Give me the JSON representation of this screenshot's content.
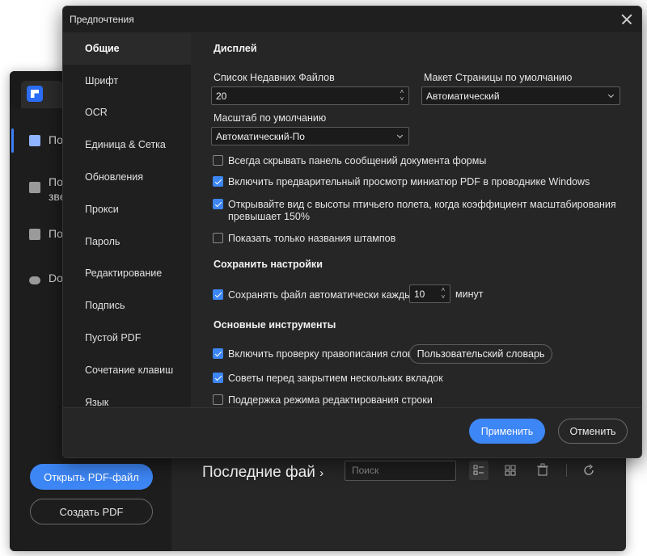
{
  "background_app": {
    "nav": [
      {
        "label": "По",
        "icon": "document-icon",
        "active": true
      },
      {
        "label": "По",
        "label2": "зве",
        "icon": "star-icon"
      },
      {
        "label": "По",
        "icon": "folder-icon"
      },
      {
        "label": "Do",
        "icon": "cloud-icon"
      }
    ],
    "open_pdf_label": "Открыть PDF-файл",
    "create_pdf_label": "Создать PDF",
    "recent_title": "Последние фай",
    "search_placeholder": "Поиск"
  },
  "dialog": {
    "title": "Предпочтения",
    "nav": [
      {
        "label": "Общие",
        "active": true
      },
      {
        "label": "Шрифт"
      },
      {
        "label": "OCR"
      },
      {
        "label": "Единица & Сетка"
      },
      {
        "label": "Обновления"
      },
      {
        "label": "Прокси"
      },
      {
        "label": "Пароль"
      },
      {
        "label": "Редактирование"
      },
      {
        "label": "Подпись"
      },
      {
        "label": "Пустой PDF"
      },
      {
        "label": "Сочетание клавиш"
      },
      {
        "label": "Язык"
      }
    ],
    "display": {
      "heading": "Дисплей",
      "recent_files_label": "Список Недавних Файлов",
      "recent_files_value": "20",
      "page_layout_label": "Макет Страницы по умолчанию",
      "page_layout_value": "Автоматический",
      "zoom_label": "Масштаб по умолчанию",
      "zoom_value": "Автоматический-По",
      "checkboxes": [
        {
          "label": "Всегда скрывать панель сообщений документа формы",
          "checked": false
        },
        {
          "label": "Включить предварительный просмотр миниатюр PDF в проводнике Windows",
          "checked": true
        },
        {
          "label": "Открывайте вид с высоты птичьего полета, когда коэффициент масштабирования",
          "label2": "превышает 150%",
          "checked": true
        },
        {
          "label": "Показать только названия штампов",
          "checked": false
        }
      ]
    },
    "save": {
      "heading": "Сохранить настройки",
      "autosave_label": "Сохранять файл автоматически каждые",
      "autosave_checked": true,
      "autosave_value": "10",
      "autosave_unit": "минут"
    },
    "tools": {
      "heading": "Основные инструменты",
      "spellcheck_label": "Включить проверку правописания слов",
      "spellcheck_checked": true,
      "custom_dict_label": "Пользовательский словарь",
      "tips_label": "Советы перед закрытием нескольких вкладок",
      "tips_checked": true,
      "line_edit_label": "Поддержка режима редактирования строки",
      "line_edit_checked": false
    },
    "apply_label": "Применить",
    "cancel_label": "Отменить"
  }
}
